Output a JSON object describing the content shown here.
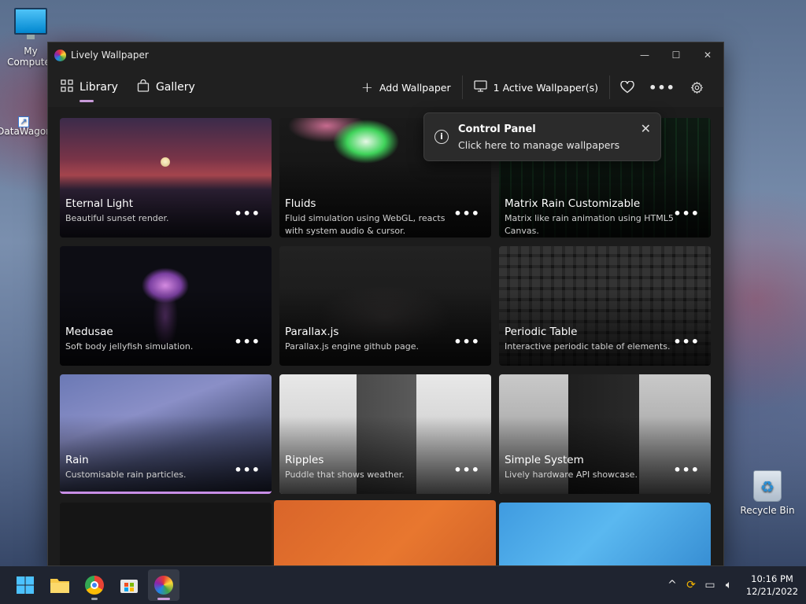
{
  "desktop": {
    "icons": [
      {
        "label": "My Computer",
        "icon": "computer-icon"
      },
      {
        "label": "DataWagon",
        "icon": "shortcut-icon"
      },
      {
        "label": "Recycle Bin",
        "icon": "recycle-bin-icon"
      }
    ]
  },
  "window": {
    "title": "Lively Wallpaper",
    "controls": {
      "minimize": "—",
      "maximize": "☐",
      "close": "✕"
    }
  },
  "nav": {
    "tabs": [
      {
        "label": "Library",
        "icon": "grid-icon",
        "active": true
      },
      {
        "label": "Gallery",
        "icon": "shopping-bag-icon",
        "active": false
      }
    ],
    "add_wallpaper": "Add Wallpaper",
    "active_wallpapers": "1 Active Wallpaper(s)"
  },
  "tooltip": {
    "title": "Control Panel",
    "subtitle": "Click here to manage wallpapers"
  },
  "wallpapers": [
    {
      "title": "Eternal Light",
      "desc": "Beautiful sunset render."
    },
    {
      "title": "Fluids",
      "desc": "Fluid simulation using WebGL, reacts with system audio & cursor."
    },
    {
      "title": "Matrix Rain Customizable",
      "desc": "Matrix like rain animation using HTML5 Canvas."
    },
    {
      "title": "Medusae",
      "desc": "Soft body jellyfish simulation."
    },
    {
      "title": "Parallax.js",
      "desc": "Parallax.js engine github page."
    },
    {
      "title": "Periodic Table",
      "desc": "Interactive periodic table of elements."
    },
    {
      "title": "Rain",
      "desc": "Customisable rain particles."
    },
    {
      "title": "Ripples",
      "desc": "Puddle that shows weather."
    },
    {
      "title": "Simple System",
      "desc": "Lively hardware API showcase."
    }
  ],
  "more_glyph": "•••",
  "taskbar": {
    "time": "10:16 PM",
    "date": "12/21/2022"
  }
}
